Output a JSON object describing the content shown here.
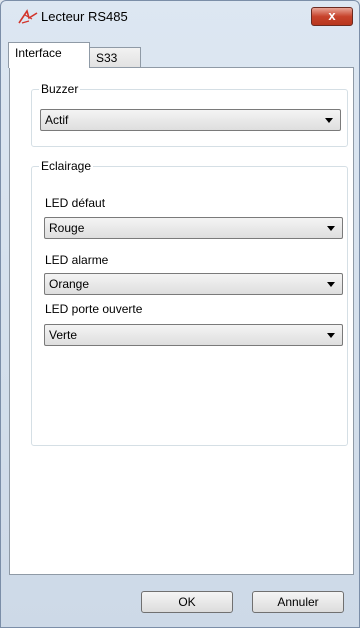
{
  "window": {
    "title": "Lecteur RS485",
    "app_icon": "reader-signal-icon",
    "close_label": "x"
  },
  "tabs": [
    {
      "label": "Interface",
      "active": true
    },
    {
      "label": "S33",
      "active": false
    }
  ],
  "buzzer": {
    "legend": "Buzzer",
    "value": "Actif"
  },
  "eclairage": {
    "legend": "Eclairage",
    "led_defaut": {
      "label": "LED défaut",
      "value": "Rouge"
    },
    "led_alarme": {
      "label": "LED alarme",
      "value": "Orange"
    },
    "led_porte": {
      "label": "LED porte ouverte",
      "value": "Verte"
    }
  },
  "buttons": {
    "ok": "OK",
    "cancel": "Annuler"
  },
  "colors": {
    "close_button": "#c7432b",
    "tab_active": "#ffffff",
    "icon_red": "#d2342b"
  }
}
